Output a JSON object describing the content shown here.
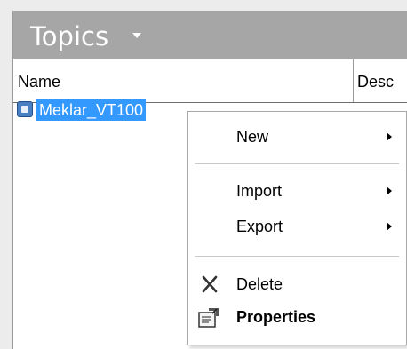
{
  "panel": {
    "title": "Topics",
    "columns": [
      "Name",
      "Desc"
    ]
  },
  "tree": {
    "item_label": "Meklar_VT100",
    "selected": true
  },
  "context_menu": {
    "items": [
      {
        "label": "New",
        "submenu": true
      },
      {
        "label": "Import",
        "submenu": true
      },
      {
        "label": "Export",
        "submenu": true
      },
      {
        "label": "Delete",
        "icon": "delete-x-icon"
      },
      {
        "label": "Properties",
        "icon": "properties-icon",
        "bold": true
      }
    ]
  },
  "colors": {
    "title_bar": "#a6a6a6",
    "selection": "#3399ff"
  }
}
